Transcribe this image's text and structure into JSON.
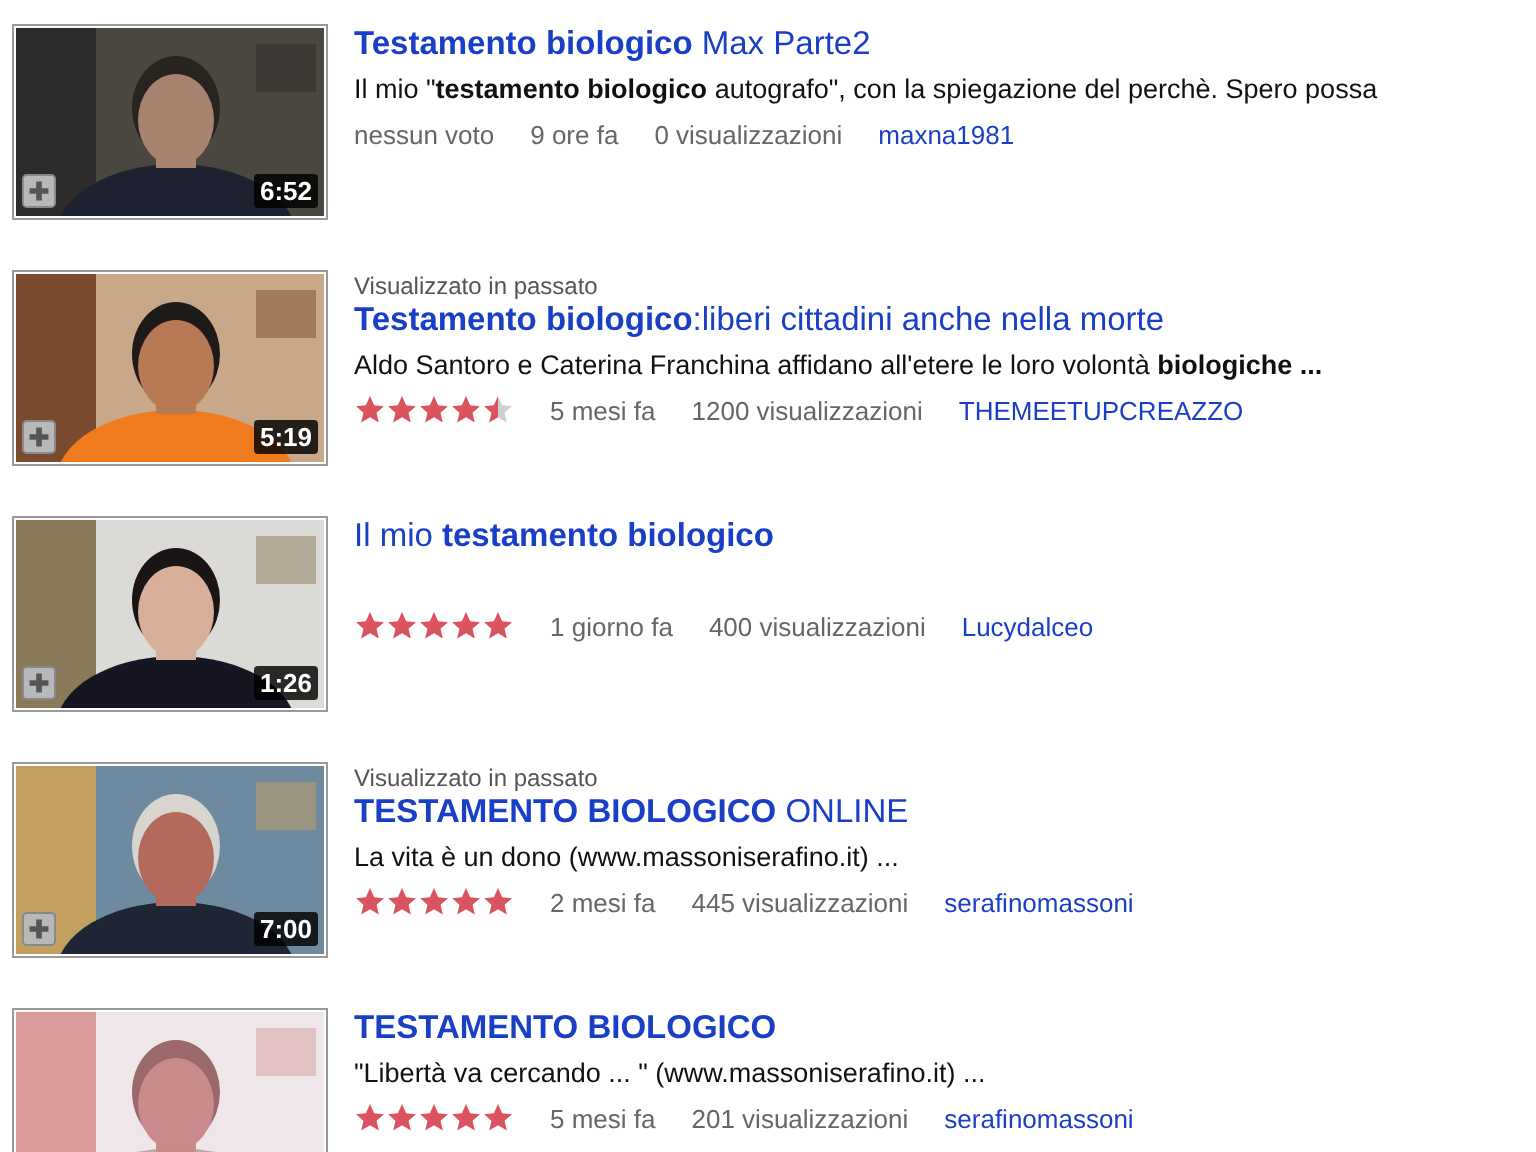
{
  "results": [
    {
      "title": "**Testamento biologico** Max Parte2",
      "title_bold": false,
      "description": "Il mio \"**testamento biologico** autografo\", con la spiegazione del perchè. Spero possa",
      "rating_text": "nessun voto",
      "age": "9 ore fa",
      "views": "0 visualizzazioni",
      "user": "maxna1981",
      "duration": "6:52"
    },
    {
      "watched_label": "Visualizzato in passato",
      "title": "**Testamento biologico**:liberi cittadini anche nella morte",
      "title_bold": false,
      "description": "Aldo Santoro e Caterina Franchina affidano all'etere le loro volontà **biologiche ...**",
      "stars": 4.5,
      "age": "5 mesi fa",
      "views": "1200 visualizzazioni",
      "user": "THEMEETUPCREAZZO",
      "duration": "5:19"
    },
    {
      "title": "Il mio **testamento biologico**",
      "title_bold": false,
      "stars": 5,
      "age": "1 giorno fa",
      "views": "400 visualizzazioni",
      "user": "Lucydalceo",
      "duration": "1:26"
    },
    {
      "watched_label": "Visualizzato in passato",
      "title": "**TESTAMENTO BIOLOGICO** ONLINE",
      "title_bold": false,
      "description": "La vita è un dono (www.massoniserafino.it) ...",
      "stars": 5,
      "age": "2 mesi fa",
      "views": "445 visualizzazioni",
      "user": "serafinomassoni",
      "duration": "7:00"
    },
    {
      "title": "TESTAMENTO BIOLOGICO",
      "title_bold": true,
      "description": "\"Libertà va cercando ... \" (www.massoniserafino.it) ...",
      "stars": 5,
      "age": "5 mesi fa",
      "views": "201 visualizzazioni",
      "user": "serafinomassoni"
    }
  ]
}
